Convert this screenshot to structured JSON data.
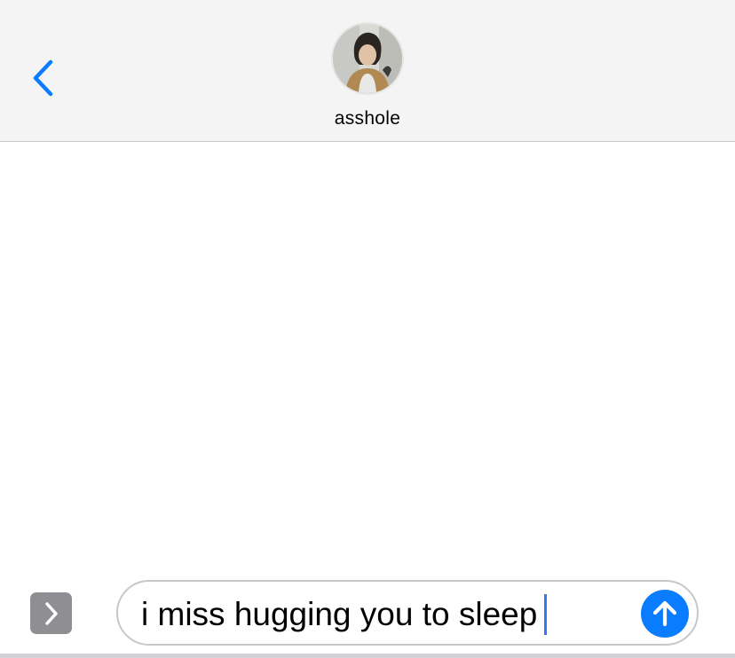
{
  "header": {
    "contact_name": "asshole",
    "back_icon": "chevron-left-icon",
    "accent_color": "#0a7cff"
  },
  "composer": {
    "message_text": "i miss hugging you to sleep",
    "apps_icon": "chevron-right-icon",
    "send_icon": "arrow-up-icon"
  }
}
